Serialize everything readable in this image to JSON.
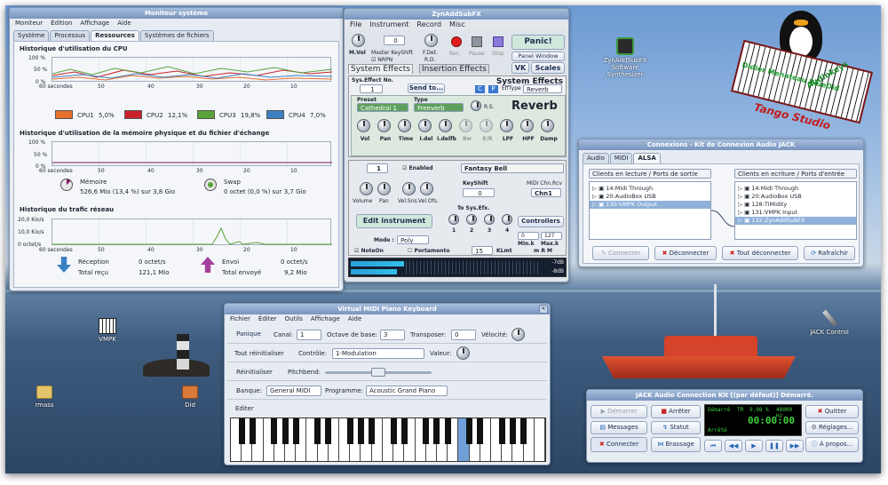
{
  "sysmon": {
    "title": "Moniteur système",
    "menu": [
      "Moniteur",
      "Édition",
      "Affichage",
      "Aide"
    ],
    "tabs": [
      "Système",
      "Processus",
      "Ressources",
      "Systèmes de fichiers"
    ],
    "cpu": {
      "title": "Historique d'utilisation du CPU",
      "yticks": [
        "100 %",
        "50 %",
        "0 %"
      ],
      "xticks": [
        "60 secondes",
        "50",
        "40",
        "30",
        "20",
        "10"
      ],
      "legend": [
        {
          "label": "CPU1",
          "value": "5,0%",
          "color": "#e8702a"
        },
        {
          "label": "CPU2",
          "value": "12,1%",
          "color": "#c8232c"
        },
        {
          "label": "CPU3",
          "value": "19,8%",
          "color": "#5aa33a"
        },
        {
          "label": "CPU4",
          "value": "7,0%",
          "color": "#3d7fc2"
        }
      ]
    },
    "mem": {
      "title": "Historique d'utilisation de la mémoire physique et du fichier d'échange",
      "yticks": [
        "100 %",
        "50 %",
        "0 %"
      ],
      "mem_label": "Mémoire",
      "mem_value": "526,6 Mio (13,4 %) sur 3,8 Gio",
      "swap_label": "Swap",
      "swap_value": "0 octet (0,0 %) sur 3,7 Gio"
    },
    "net": {
      "title": "Historique du trafic réseau",
      "yticks": [
        "20,0 Kio/s",
        "10,0 Kio/s",
        "0 octet/s"
      ],
      "rx_label": "Réception",
      "rx_value": "0 octet/s",
      "rx_total_label": "Total reçu",
      "rx_total": "121,1 Mio",
      "tx_label": "Envoi",
      "tx_value": "0 octet/s",
      "tx_total_label": "Total envoyé",
      "tx_total": "9,2 Mio"
    }
  },
  "zyn": {
    "title": "ZynAddSubFX",
    "menu": [
      "File",
      "Instrument",
      "Record",
      "Misc"
    ],
    "mvol": "M.Vol",
    "master_keyshift": "Master KeyShift",
    "keyshift_value": "0",
    "nrpn": "NRPN",
    "fdet": "F.Det.",
    "rd": "R.D.",
    "rec": "Rec.",
    "pause": "Pause",
    "stop": "Stop",
    "panic": "Panic!",
    "panel_window": "Panel Window",
    "vk": "VK",
    "scales": "Scales",
    "tab_sys": "System Effects",
    "tab_ins": "Insertion Effects",
    "sys_effects": "System Effects",
    "sysno_label": "Sys.Effect No.",
    "sysno": "1",
    "send_to": "Send to...",
    "c": "C",
    "p": "P",
    "efftype_label": "EffType",
    "efftype": "Reverb",
    "preset_label": "Preset",
    "preset": "Cathedral 1",
    "type_label": "Type",
    "type": "Freeverb",
    "rs": "R.S.",
    "reverb": "Reverb",
    "knobs": [
      "Vol",
      "Pan",
      "Time",
      "I.del",
      "I.delfb",
      "Bw",
      "E/R",
      "LPF",
      "HPF",
      "Damp"
    ],
    "part": "1",
    "enabled": "Enabled",
    "instrument_name": "Fantasy Bell",
    "keyshift_label": "KeyShift",
    "keyshift2": "0",
    "midi_label": "MIDI Chn.Rcv",
    "midi_chn": "Chn1",
    "part_knobs": [
      "Volume",
      "Pan",
      "Vel.Sns.",
      "Vel.Ofs."
    ],
    "to_sys": "To Sys.Efx.",
    "sys_nums": [
      "1",
      "2",
      "3",
      "4"
    ],
    "edit_instrument": "Edit instrument",
    "controllers": "Controllers",
    "mode_label": "Mode :",
    "mode": "Poly",
    "mink": "Min.k",
    "maxk": "Max.k",
    "mink_v": "0",
    "maxk_v": "127",
    "mrk": "m R M",
    "noteon": "NoteOn",
    "portamento": "Portamento",
    "klmt_v": "15",
    "klmt": "KLmt",
    "db1": "-7dB",
    "db2": "-8dB"
  },
  "jack": {
    "title": "Connexions - Kit de Connexion Audio JACK",
    "tabs": [
      "Audio",
      "MIDI",
      "ALSA"
    ],
    "left_header": "Clients en lecture / Ports de sortie",
    "right_header": "Clients en ecriture / Ports d'entrée",
    "left": [
      "14:Midi Through",
      "20:AudioBox USB",
      "130:VMPK Output"
    ],
    "right": [
      "14:Midi Through",
      "20:AudioBox USB",
      "128:TiMidity",
      "131:VMPK Input",
      "132:ZynAddSubFX"
    ],
    "btn_connect": "Connecter",
    "btn_disconnect": "Déconnecter",
    "btn_disconnect_all": "Tout déconnecter",
    "btn_refresh": "Rafraîchir"
  },
  "vmpk": {
    "title": "Virtual MIDI Piano Keyboard",
    "menu": [
      "Fichier",
      "Éditer",
      "Outils",
      "Affichage",
      "Aide"
    ],
    "panique": "Panique",
    "canal_label": "Canal:",
    "canal": "1",
    "octave_label": "Octave de base:",
    "octave": "3",
    "transposer_label": "Transposer:",
    "transposer": "0",
    "velocite": "Vélocité:",
    "reset_all": "Tout réinitialiser",
    "controle_label": "Contrôle:",
    "controle": "1-Modulation",
    "valeur_label": "Valeur:",
    "reset": "Réinitialiser",
    "pitchbend": "Pitchbend:",
    "banque_label": "Banque:",
    "banque": "General MIDI",
    "programme_label": "Programme:",
    "programme": "Acoustic Grand Piano",
    "editer": "Editer"
  },
  "qjack": {
    "title": "JACK Audio Connection Kit [(par défaut)] Démarré.",
    "btn_start": "Démarrer",
    "btn_stop": "Arrêter",
    "btn_quit": "Quitter",
    "btn_messages": "Messages",
    "btn_status": "Statut",
    "btn_setup": "Réglages...",
    "btn_connect": "Connecter",
    "btn_patchbay": "Brassage",
    "btn_about": "À propos...",
    "status": "Démarré",
    "rt": "TR",
    "load": "9.98 %",
    "rate": "48000 Hz",
    "time": "00:00:00",
    "stopped": "Arrêté"
  },
  "desktop": {
    "icons": [
      {
        "label": "ZynAddSubFX Software Synthesizer"
      },
      {
        "label": "VMPK"
      },
      {
        "label": "JACK Control"
      },
      {
        "label": "rmass"
      },
      {
        "label": "Did"
      }
    ],
    "logo": {
      "audiokeys": "Audiokeys",
      "line1": "Didier Menateau BlueDid",
      "line2": "Tango Studio"
    }
  }
}
